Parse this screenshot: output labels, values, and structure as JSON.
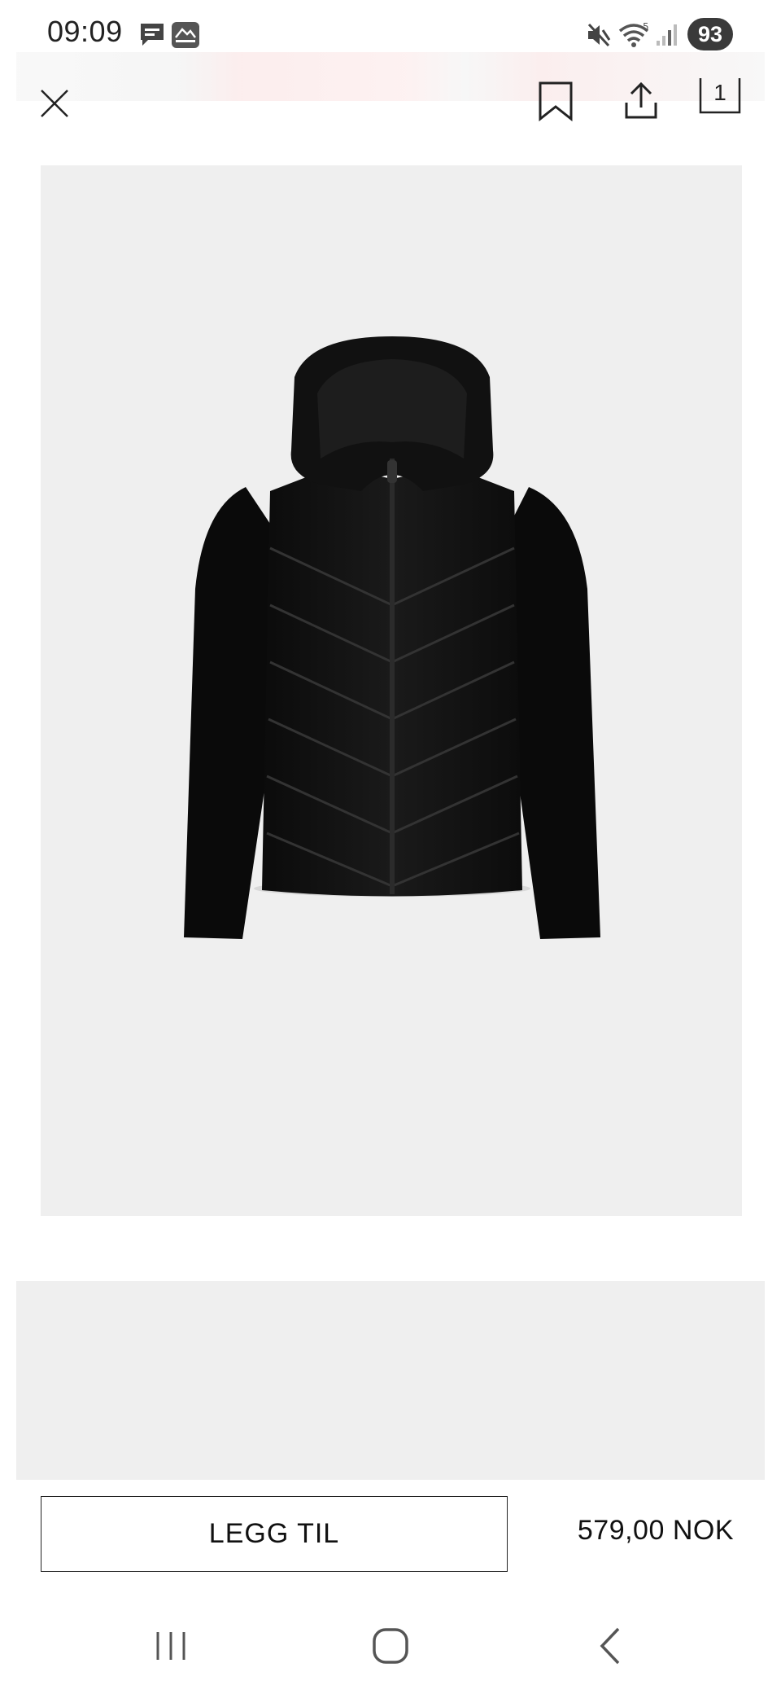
{
  "status_bar": {
    "time": "09:09",
    "battery": "93",
    "notification_icons": [
      "message-icon",
      "mydlink-icon"
    ],
    "system_icons": [
      "mute-icon",
      "wifi-icon",
      "signal-icon"
    ]
  },
  "toolbar": {
    "close_icon": "close-icon",
    "bookmark_icon": "bookmark-icon",
    "share_icon": "share-icon",
    "bag_count": "1"
  },
  "product": {
    "image_alt": "black-quilted-hybrid-jacket",
    "add_label": "LEGG TIL",
    "price": "579,00 NOK"
  },
  "nav": {
    "recents_icon": "recents-icon",
    "home_icon": "home-icon",
    "back_icon": "back-icon"
  }
}
